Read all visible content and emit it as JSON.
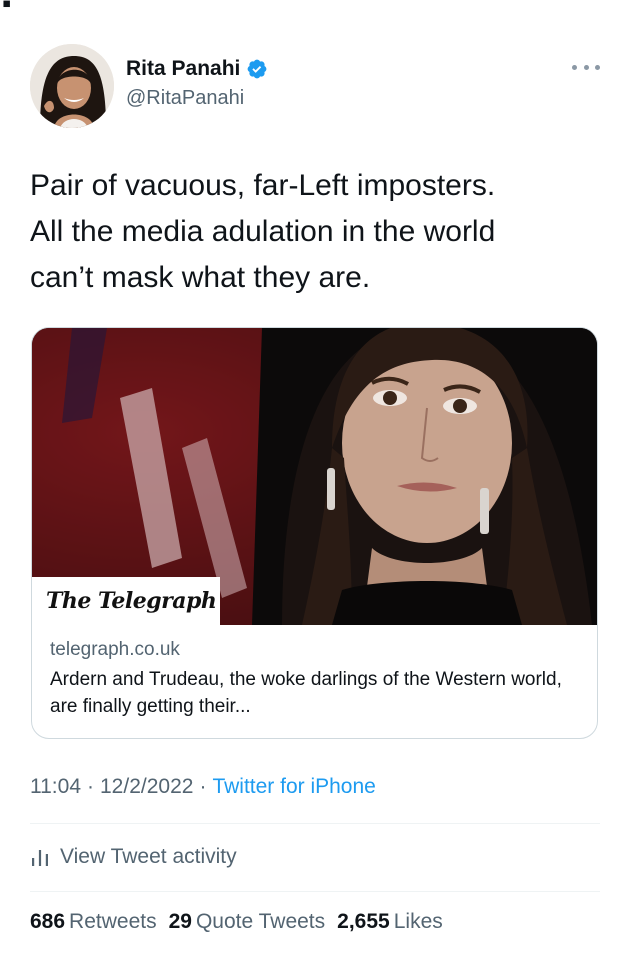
{
  "author": {
    "display_name": "Rita Panahi",
    "handle": "@RitaPanahi",
    "verified": true
  },
  "tweet": {
    "text": "Pair of vacuous, far-Left imposters.\nAll the media adulation in the world\ncan’t mask what they are."
  },
  "link_card": {
    "publisher": "The Telegraph",
    "domain": "telegraph.co.uk",
    "description": "Ardern and Trudeau, the woke darlings of the Western world, are finally getting their..."
  },
  "meta": {
    "time": "11:04",
    "date": "12/2/2022",
    "separator": "·",
    "source": "Twitter for iPhone"
  },
  "activity": {
    "label": "View Tweet activity"
  },
  "stats": {
    "retweets_count": "686",
    "retweets_label": "Retweets",
    "quotes_count": "29",
    "quotes_label": "Quote Tweets",
    "likes_count": "2,655",
    "likes_label": "Likes"
  },
  "colors": {
    "text": "#0f1419",
    "secondary": "#536471",
    "link": "#1d9bf0",
    "verified": "#1d9bf0",
    "border": "#cfd9de"
  },
  "icons": {
    "verified": "verified-badge-icon",
    "more": "more-dots-icon",
    "activity": "bar-chart-icon"
  }
}
